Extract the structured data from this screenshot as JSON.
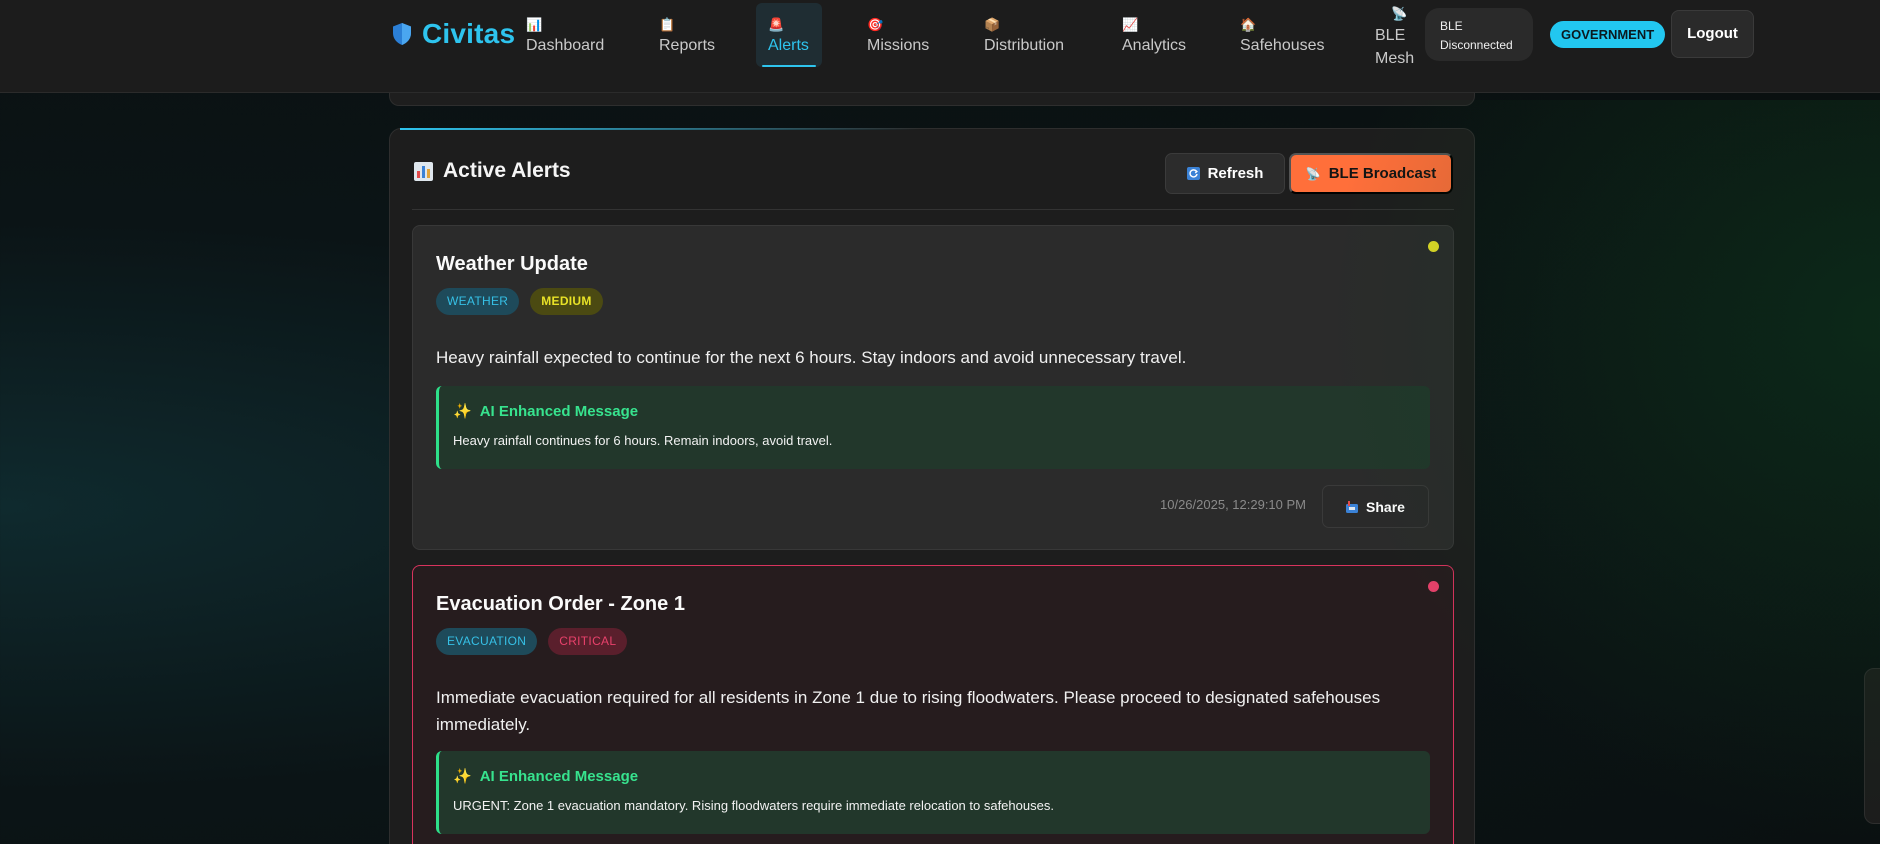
{
  "app": {
    "name": "Civitas",
    "brand_color": "#2ec4ee"
  },
  "nav": {
    "items": [
      {
        "label": "Dashboard",
        "icon": "bar-chart-icon"
      },
      {
        "label": "Reports",
        "icon": "clipboard-icon"
      },
      {
        "label": "Alerts",
        "icon": "siren-icon",
        "active": true
      },
      {
        "label": "Missions",
        "icon": "target-icon"
      },
      {
        "label": "Distribution",
        "icon": "package-icon"
      },
      {
        "label": "Analytics",
        "icon": "line-chart-icon"
      },
      {
        "label": "Safehouses",
        "icon": "house-icon"
      },
      {
        "label_line1": "BLE",
        "label_line2": "Mesh",
        "icon": "satellite-dish-icon"
      }
    ],
    "ble_status": {
      "line1": "BLE",
      "line2": "Disconnected"
    },
    "role_badge": "GOVERNMENT",
    "logout_label": "Logout"
  },
  "panel": {
    "title": "Active Alerts",
    "refresh_label": "Refresh",
    "broadcast_label": "BLE Broadcast"
  },
  "alerts": [
    {
      "title": "Weather Update",
      "type": "WEATHER",
      "severity": "MEDIUM",
      "severity_color": "#e8e227",
      "message": "Heavy rainfall expected to continue for the next 6 hours. Stay indoors and avoid unnecessary travel.",
      "ai_heading": "AI Enhanced Message",
      "ai_message": "Heavy rainfall continues for 6 hours. Remain indoors, avoid travel.",
      "timestamp": "10/26/2025, 12:29:10 PM",
      "share_label": "Share"
    },
    {
      "title": "Evacuation Order - Zone 1",
      "type": "EVACUATION",
      "severity": "CRITICAL",
      "severity_color": "#e8416b",
      "message": "Immediate evacuation required for all residents in Zone 1 due to rising floodwaters. Please proceed to designated safehouses immediately.",
      "ai_heading": "AI Enhanced Message",
      "ai_message": "URGENT: Zone 1 evacuation mandatory. Rising floodwaters require immediate relocation to safehouses."
    }
  ]
}
